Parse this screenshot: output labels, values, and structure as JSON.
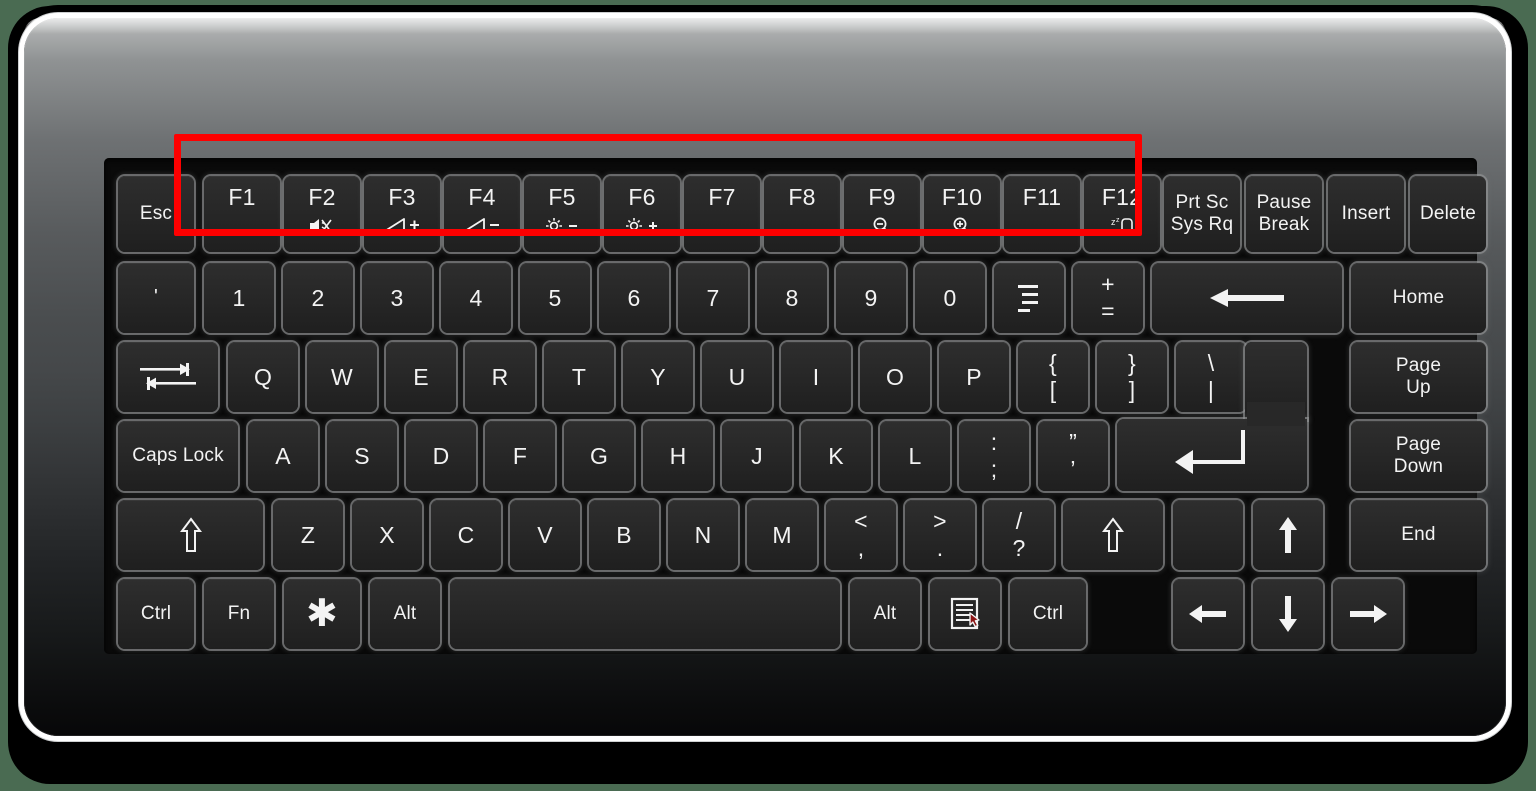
{
  "device": {
    "name": "compact-keyboard",
    "bezel_color": "#45484a",
    "key_color": "#262626",
    "legend_color": "#f3f3f3",
    "highlight_color": "#fe0000",
    "background_color": "#4a6b52"
  },
  "highlight": {
    "name": "function-row-highlight",
    "target": "F1 through F12",
    "color": "#fe0000"
  },
  "rows": [
    {
      "name": "function-row",
      "keys": [
        {
          "label": "Esc",
          "name": "esc"
        },
        {
          "label": "F1",
          "name": "f1"
        },
        {
          "label": "F2",
          "name": "f2",
          "sub": "mute-icon"
        },
        {
          "label": "F3",
          "name": "f3",
          "sub": "volume-up-icon",
          "sub_text": "+"
        },
        {
          "label": "F4",
          "name": "f4",
          "sub": "volume-down-icon",
          "sub_text": "−"
        },
        {
          "label": "F5",
          "name": "f5",
          "sub": "brightness-down-icon",
          "sub_text": "−"
        },
        {
          "label": "F6",
          "name": "f6",
          "sub": "brightness-up-icon",
          "sub_text": "+"
        },
        {
          "label": "F7",
          "name": "f7"
        },
        {
          "label": "F8",
          "name": "f8"
        },
        {
          "label": "F9",
          "name": "f9",
          "sub": "zoom-out-icon"
        },
        {
          "label": "F10",
          "name": "f10",
          "sub": "zoom-in-icon"
        },
        {
          "label": "F11",
          "name": "f11"
        },
        {
          "label": "F12",
          "name": "f12",
          "sub": "sleep-icon",
          "sub_text": "Zz"
        },
        {
          "label": "Prt Sc\nSys Rq",
          "name": "print-screen"
        },
        {
          "label": "Pause\nBreak",
          "name": "pause-break"
        },
        {
          "label": "Insert",
          "name": "insert"
        },
        {
          "label": "Delete",
          "name": "delete"
        }
      ]
    },
    {
      "name": "number-row",
      "keys": [
        {
          "label": "'",
          "name": "apostrophe-grave"
        },
        {
          "label": "1",
          "name": "digit-1"
        },
        {
          "label": "2",
          "name": "digit-2"
        },
        {
          "label": "3",
          "name": "digit-3"
        },
        {
          "label": "4",
          "name": "digit-4"
        },
        {
          "label": "5",
          "name": "digit-5"
        },
        {
          "label": "6",
          "name": "digit-6"
        },
        {
          "label": "7",
          "name": "digit-7"
        },
        {
          "label": "8",
          "name": "digit-8"
        },
        {
          "label": "9",
          "name": "digit-9"
        },
        {
          "label": "0",
          "name": "digit-0"
        },
        {
          "label": "_\n-",
          "name": "minus-underscore",
          "glyph": "underscore-hyphen-icon"
        },
        {
          "label": "+\n=",
          "name": "equals-plus",
          "top": "+",
          "bot": "="
        },
        {
          "label": "",
          "name": "backspace",
          "glyph": "backspace-arrow-icon"
        },
        {
          "label": "Home",
          "name": "home"
        }
      ]
    },
    {
      "name": "qwerty-row",
      "keys": [
        {
          "label": "",
          "name": "tab",
          "glyph": "tab-icon"
        },
        {
          "label": "Q",
          "name": "letter-q"
        },
        {
          "label": "W",
          "name": "letter-w"
        },
        {
          "label": "E",
          "name": "letter-e"
        },
        {
          "label": "R",
          "name": "letter-r"
        },
        {
          "label": "T",
          "name": "letter-t"
        },
        {
          "label": "Y",
          "name": "letter-y"
        },
        {
          "label": "U",
          "name": "letter-u"
        },
        {
          "label": "I",
          "name": "letter-i"
        },
        {
          "label": "O",
          "name": "letter-o"
        },
        {
          "label": "P",
          "name": "letter-p"
        },
        {
          "label": "{\n[",
          "name": "bracket-left",
          "top": "{",
          "bot": "["
        },
        {
          "label": "}\n]",
          "name": "bracket-right",
          "top": "}",
          "bot": "]"
        },
        {
          "label": "\\\n|",
          "name": "backslash-pipe",
          "top": "\\",
          "bot": "|"
        },
        {
          "label": "Page\nUp",
          "name": "page-up"
        }
      ]
    },
    {
      "name": "home-row",
      "keys": [
        {
          "label": "Caps Lock",
          "name": "caps-lock"
        },
        {
          "label": "A",
          "name": "letter-a"
        },
        {
          "label": "S",
          "name": "letter-s"
        },
        {
          "label": "D",
          "name": "letter-d"
        },
        {
          "label": "F",
          "name": "letter-f"
        },
        {
          "label": "G",
          "name": "letter-g"
        },
        {
          "label": "H",
          "name": "letter-h"
        },
        {
          "label": "J",
          "name": "letter-j"
        },
        {
          "label": "K",
          "name": "letter-k"
        },
        {
          "label": "L",
          "name": "letter-l"
        },
        {
          "label": ":\n;",
          "name": "semicolon-colon",
          "top": ":",
          "bot": ";"
        },
        {
          "label": "\"\n'",
          "name": "quote-apostrophe",
          "top": "”",
          "bot": "’"
        },
        {
          "label": "",
          "name": "enter",
          "glyph": "enter-arrow-icon"
        },
        {
          "label": "Page\nDown",
          "name": "page-down"
        }
      ]
    },
    {
      "name": "shift-row",
      "keys": [
        {
          "label": "⇧",
          "name": "shift-left",
          "glyph": "shift-arrow-icon"
        },
        {
          "label": "Z",
          "name": "letter-z"
        },
        {
          "label": "X",
          "name": "letter-x"
        },
        {
          "label": "C",
          "name": "letter-c"
        },
        {
          "label": "V",
          "name": "letter-v"
        },
        {
          "label": "B",
          "name": "letter-b"
        },
        {
          "label": "N",
          "name": "letter-n"
        },
        {
          "label": "M",
          "name": "letter-m"
        },
        {
          "label": "<\n,",
          "name": "comma-less-than",
          "top": "<",
          "bot": ","
        },
        {
          "label": ">\n.",
          "name": "period-greater-than",
          "top": ">",
          "bot": "."
        },
        {
          "label": "/\n?",
          "name": "slash-question",
          "top": "/",
          "bot": "?"
        },
        {
          "label": "⇧",
          "name": "shift-right",
          "glyph": "shift-arrow-icon"
        },
        {
          "label": "",
          "name": "blank-key"
        },
        {
          "label": "",
          "name": "arrow-up",
          "glyph": "arrow-up-icon"
        },
        {
          "label": "End",
          "name": "end"
        }
      ]
    },
    {
      "name": "bottom-row",
      "keys": [
        {
          "label": "Ctrl",
          "name": "ctrl-left"
        },
        {
          "label": "Fn",
          "name": "fn"
        },
        {
          "label": "✱",
          "name": "star-key",
          "glyph": "asterisk-icon"
        },
        {
          "label": "Alt",
          "name": "alt-left"
        },
        {
          "label": "",
          "name": "space"
        },
        {
          "label": "Alt",
          "name": "alt-right"
        },
        {
          "label": "",
          "name": "menu",
          "glyph": "context-menu-icon"
        },
        {
          "label": "Ctrl",
          "name": "ctrl-right"
        },
        {
          "label": "",
          "name": "arrow-left",
          "glyph": "arrow-left-icon"
        },
        {
          "label": "",
          "name": "arrow-down",
          "glyph": "arrow-down-icon"
        },
        {
          "label": "",
          "name": "arrow-right",
          "glyph": "arrow-right-icon"
        }
      ]
    }
  ]
}
